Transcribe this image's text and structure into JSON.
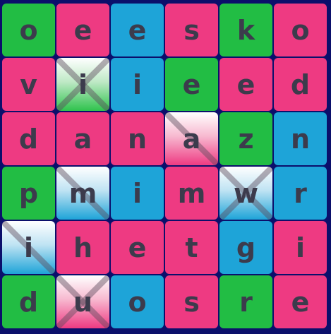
{
  "board": {
    "rows": [
      [
        {
          "letter": "o",
          "color": "green",
          "mark": "none"
        },
        {
          "letter": "e",
          "color": "pink",
          "mark": "none"
        },
        {
          "letter": "e",
          "color": "blue",
          "mark": "none"
        },
        {
          "letter": "s",
          "color": "pink",
          "mark": "none"
        },
        {
          "letter": "k",
          "color": "green",
          "mark": "none"
        },
        {
          "letter": "o",
          "color": "pink",
          "mark": "none"
        }
      ],
      [
        {
          "letter": "v",
          "color": "pink",
          "mark": "none"
        },
        {
          "letter": "i",
          "color": "fade-green",
          "mark": "cross"
        },
        {
          "letter": "i",
          "color": "blue",
          "mark": "none"
        },
        {
          "letter": "e",
          "color": "green",
          "mark": "none"
        },
        {
          "letter": "e",
          "color": "pink",
          "mark": "none"
        },
        {
          "letter": "d",
          "color": "pink",
          "mark": "none"
        }
      ],
      [
        {
          "letter": "d",
          "color": "pink",
          "mark": "none"
        },
        {
          "letter": "a",
          "color": "pink",
          "mark": "none"
        },
        {
          "letter": "n",
          "color": "pink",
          "mark": "none"
        },
        {
          "letter": "a",
          "color": "fade-pink",
          "mark": "slash"
        },
        {
          "letter": "z",
          "color": "green",
          "mark": "none"
        },
        {
          "letter": "n",
          "color": "blue",
          "mark": "none"
        }
      ],
      [
        {
          "letter": "p",
          "color": "green",
          "mark": "none"
        },
        {
          "letter": "m",
          "color": "fade-blue",
          "mark": "slash"
        },
        {
          "letter": "i",
          "color": "blue",
          "mark": "none"
        },
        {
          "letter": "m",
          "color": "pink",
          "mark": "none"
        },
        {
          "letter": "w",
          "color": "fade-blue",
          "mark": "cross"
        },
        {
          "letter": "r",
          "color": "blue",
          "mark": "none"
        }
      ],
      [
        {
          "letter": "i",
          "color": "fade-blue",
          "mark": "slash"
        },
        {
          "letter": "h",
          "color": "pink",
          "mark": "none"
        },
        {
          "letter": "e",
          "color": "pink",
          "mark": "none"
        },
        {
          "letter": "t",
          "color": "pink",
          "mark": "none"
        },
        {
          "letter": "g",
          "color": "blue",
          "mark": "none"
        },
        {
          "letter": "i",
          "color": "pink",
          "mark": "none"
        }
      ],
      [
        {
          "letter": "d",
          "color": "green",
          "mark": "none"
        },
        {
          "letter": "u",
          "color": "fade-pink",
          "mark": "cross"
        },
        {
          "letter": "o",
          "color": "blue",
          "mark": "none"
        },
        {
          "letter": "s",
          "color": "pink",
          "mark": "none"
        },
        {
          "letter": "r",
          "color": "green",
          "mark": "none"
        },
        {
          "letter": "e",
          "color": "pink",
          "mark": "none"
        }
      ]
    ]
  },
  "palette": {
    "background": "#0b0f6b",
    "green": "#22bd44",
    "pink": "#ee3a82",
    "blue": "#1ea4d8",
    "letter": "#3c3b4c",
    "mark": "#5a4a5a"
  }
}
